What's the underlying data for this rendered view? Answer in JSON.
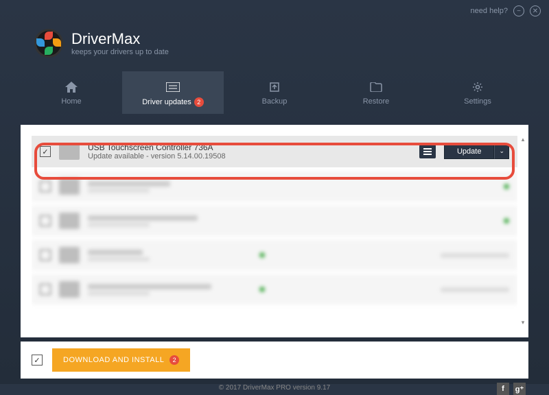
{
  "titlebar": {
    "help": "need help?"
  },
  "app": {
    "name": "DriverMax",
    "tagline": "keeps your drivers up to date"
  },
  "nav": {
    "home": "Home",
    "updates": "Driver updates",
    "updates_badge": "2",
    "backup": "Backup",
    "restore": "Restore",
    "settings": "Settings"
  },
  "drivers": {
    "highlighted": {
      "name": "USB Touchscreen Controller 736A",
      "status": "Update available - version 5.14.00.19508",
      "update_label": "Update"
    }
  },
  "bottom": {
    "download": "DOWNLOAD AND INSTALL",
    "download_badge": "2"
  },
  "footer": {
    "copyright": "© 2017 DriverMax PRO version 9.17"
  }
}
